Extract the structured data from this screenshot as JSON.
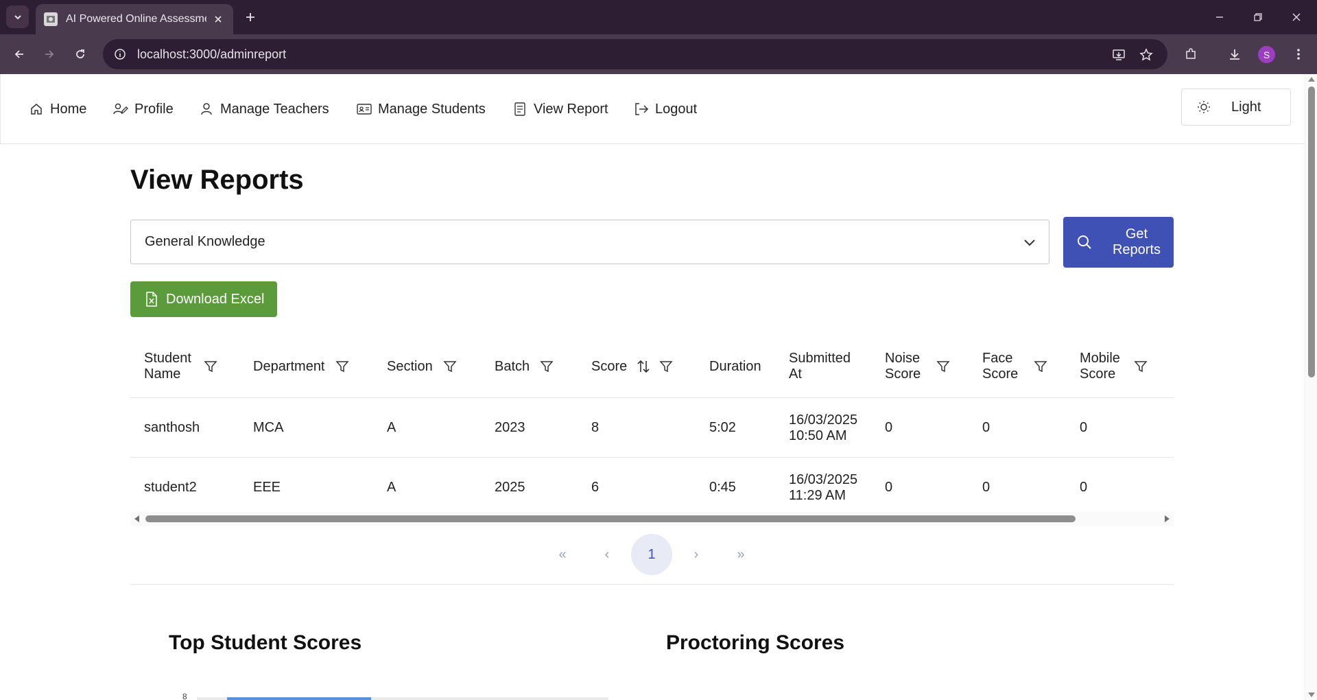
{
  "browser": {
    "tab_title": "AI Powered Online Assessment",
    "url": "localhost:3000/adminreport",
    "profile_initial": "S"
  },
  "nav": {
    "home": "Home",
    "profile": "Profile",
    "manage_teachers": "Manage Teachers",
    "manage_students": "Manage Students",
    "view_report": "View Report",
    "logout": "Logout",
    "theme_toggle": "Light"
  },
  "page": {
    "title": "View Reports",
    "subject_selected": "General Knowledge",
    "get_reports_label": "Get Reports",
    "download_excel_label": "Download Excel"
  },
  "table": {
    "headers": {
      "student_name": "Student Name",
      "department": "Department",
      "section": "Section",
      "batch": "Batch",
      "score": "Score",
      "duration": "Duration",
      "submitted_at": "Submitted At",
      "noise_score": "Noise Score",
      "face_score": "Face Score",
      "mobile_score": "Mobile Score"
    },
    "rows": [
      {
        "student_name": "santhosh",
        "department": "MCA",
        "section": "A",
        "batch": "2023",
        "score": "8",
        "duration": "5:02",
        "submitted_at": "16/03/2025 10:50 AM",
        "noise_score": "0",
        "face_score": "0",
        "mobile_score": "0"
      },
      {
        "student_name": "student2",
        "department": "EEE",
        "section": "A",
        "batch": "2025",
        "score": "6",
        "duration": "0:45",
        "submitted_at": "16/03/2025 11:29 AM",
        "noise_score": "0",
        "face_score": "0",
        "mobile_score": "0"
      }
    ]
  },
  "pagination": {
    "first": "«",
    "prev": "‹",
    "current": "1",
    "next": "›",
    "last": "»"
  },
  "sections": {
    "top_scores": "Top Student Scores",
    "proctoring_scores": "Proctoring Scores",
    "chart_axis_tick": "8"
  },
  "colors": {
    "primary": "#3f51b5",
    "success": "#5b9b3b",
    "chrome_dark": "#2e1e33",
    "chrome_mid": "#4a3a4e"
  },
  "icons": {
    "home": "home-icon",
    "profile": "user-pen-icon",
    "teachers": "user-icon",
    "students": "id-card-icon",
    "report": "document-icon",
    "logout": "logout-icon",
    "theme": "sun-icon",
    "search": "search-icon",
    "excel": "file-excel-icon",
    "filter": "filter-icon",
    "sort": "sort-icon"
  }
}
